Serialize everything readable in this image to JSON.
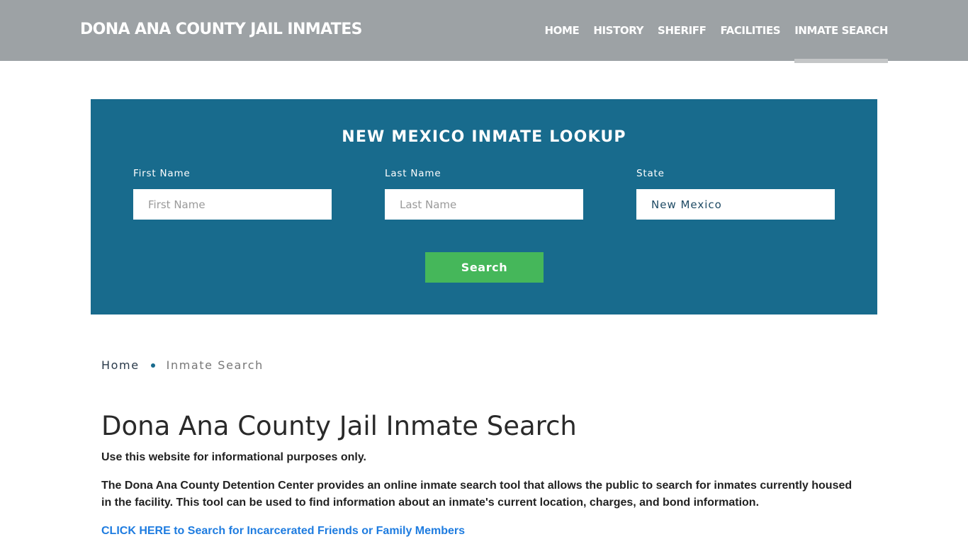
{
  "header": {
    "brand": "DONA ANA COUNTY JAIL INMATES",
    "nav": [
      {
        "label": "HOME",
        "active": false
      },
      {
        "label": "HISTORY",
        "active": false
      },
      {
        "label": "SHERIFF",
        "active": false
      },
      {
        "label": "FACILITIES",
        "active": false
      },
      {
        "label": "INMATE SEARCH",
        "active": true
      }
    ]
  },
  "lookup": {
    "title": "NEW MEXICO INMATE LOOKUP",
    "first_name": {
      "label": "First Name",
      "placeholder": "First Name",
      "value": ""
    },
    "last_name": {
      "label": "Last Name",
      "placeholder": "Last Name",
      "value": ""
    },
    "state": {
      "label": "State",
      "value": "New Mexico"
    },
    "search_label": "Search"
  },
  "breadcrumb": {
    "home": "Home",
    "current": "Inmate Search"
  },
  "content": {
    "title": "Dona Ana County Jail Inmate Search",
    "intro": "Use this website for informational purposes only.",
    "description": "The Dona Ana County Detention Center provides an online inmate search tool that allows the public to search for inmates currently housed in the facility. This tool can be used to find information about an inmate's current location, charges, and bond information.",
    "cta": "CLICK HERE to Search for Incarcerated Friends or Family Members"
  },
  "colors": {
    "header_bg": "#9da2a5",
    "panel_bg": "#186b8d",
    "button_bg": "#45b75a",
    "link": "#1e7ce0"
  }
}
